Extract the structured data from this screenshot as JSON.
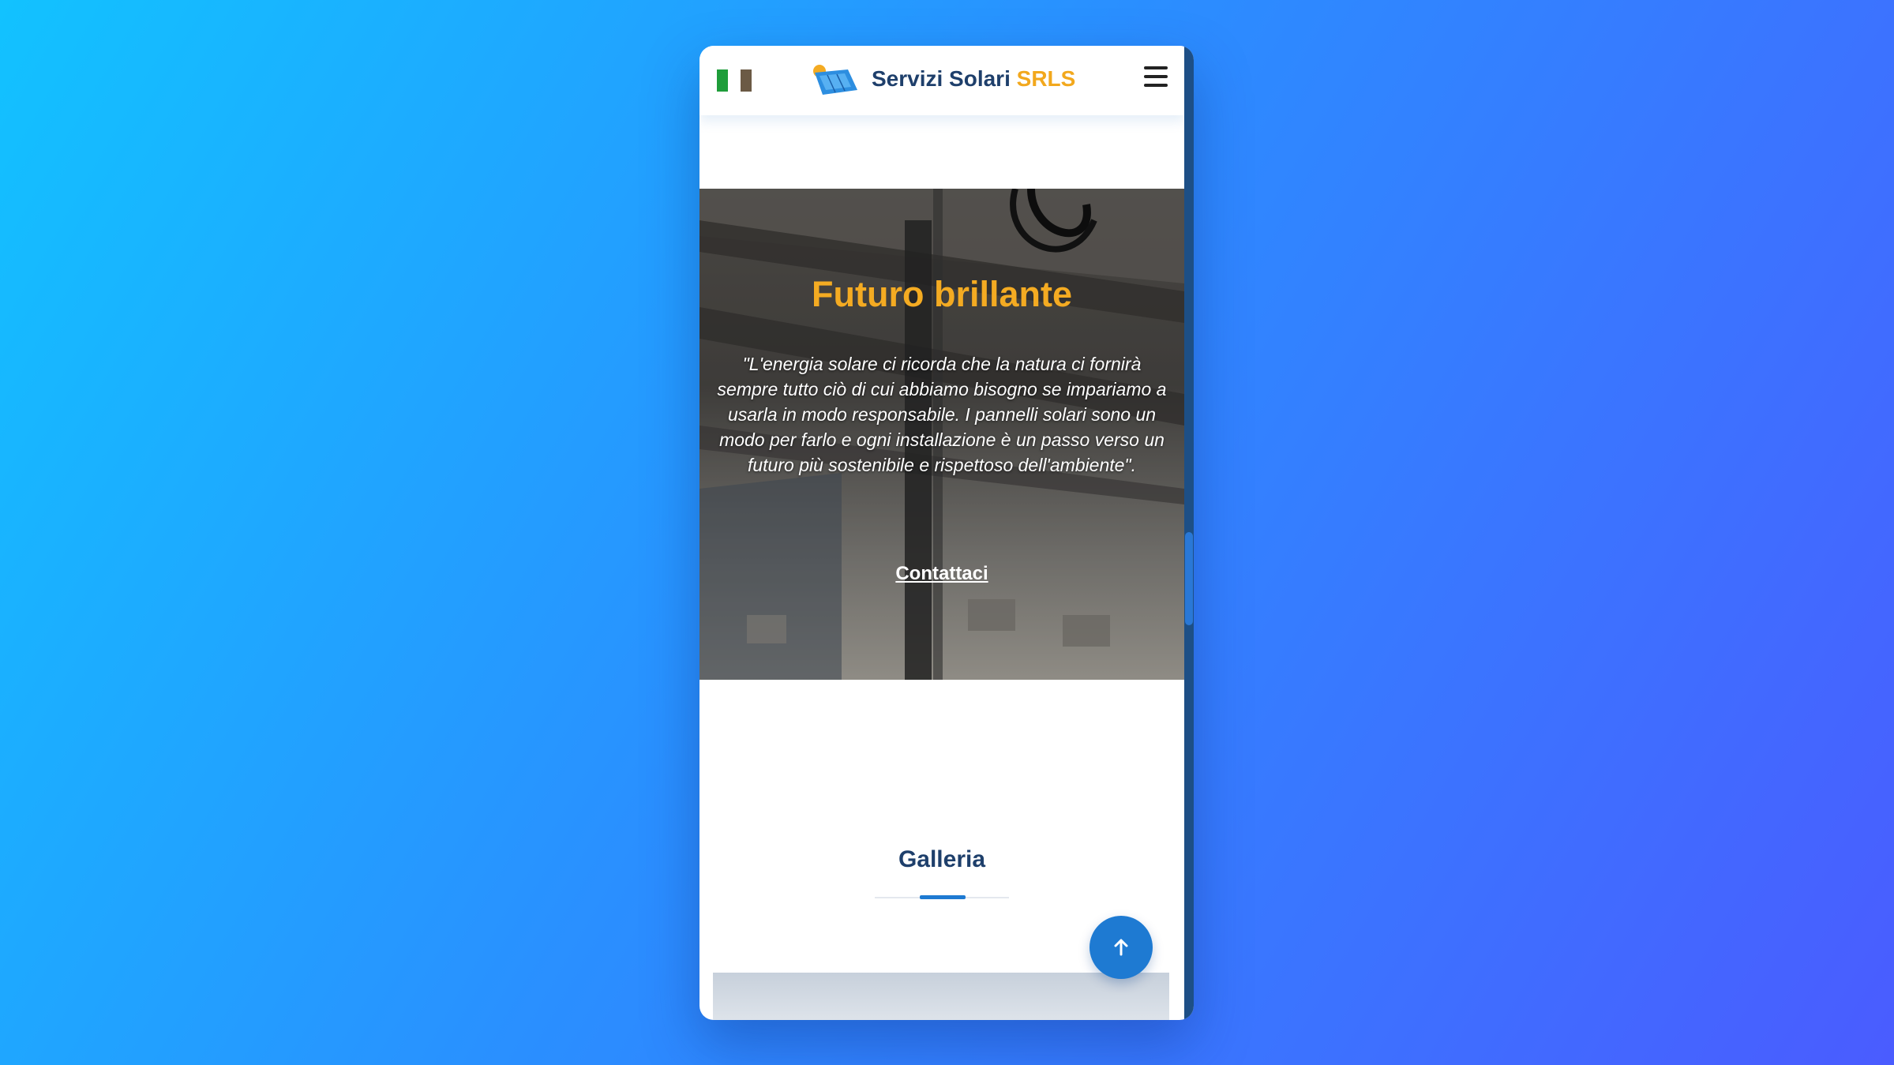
{
  "header": {
    "brand_main": "Servizi Solari",
    "brand_accent": "SRLS",
    "flag_icon": "italy-flag-icon",
    "menu_icon": "hamburger-menu-icon"
  },
  "hero": {
    "title": "Futuro brillante",
    "quote": "\"L'energia solare ci ricorda che la natura ci fornirà sempre tutto ciò di cui abbiamo bisogno se impariamo a usarla in modo responsabile. I pannelli solari sono un modo per farlo e ogni installazione è un passo verso un futuro più sostenibile e rispettoso dell'ambiente\".",
    "cta_label": "Contattaci"
  },
  "gallery": {
    "title": "Galleria"
  },
  "colors": {
    "accent": "#f4ab22",
    "brand": "#1e3f6b",
    "primary": "#1e7ad2"
  },
  "scroll_to_top_icon": "arrow-up-icon"
}
